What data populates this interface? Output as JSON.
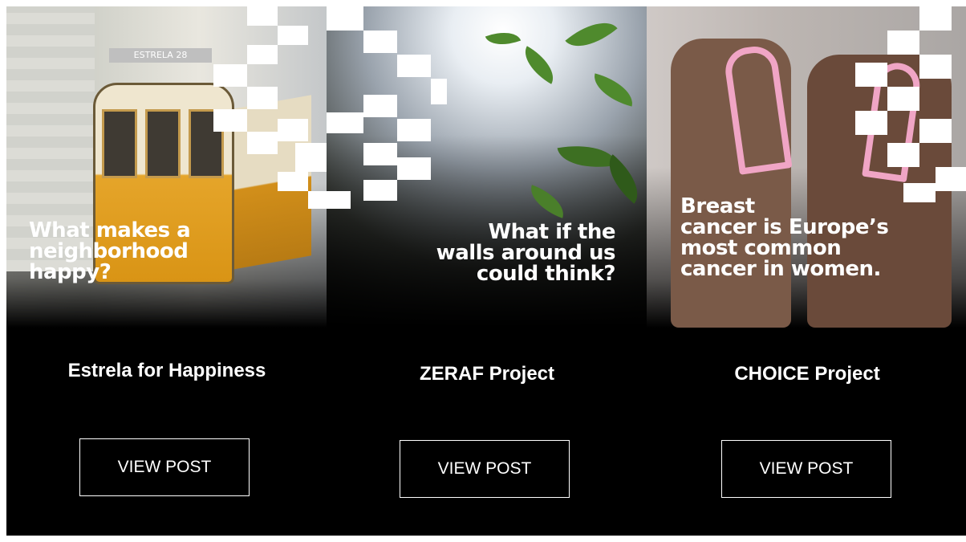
{
  "cards": [
    {
      "image_caption": "What makes a\nneighborhood\nhappy?",
      "street_sign": "ESTRELA 28",
      "title": "Estrela for Happiness",
      "button_label": "VIEW POST"
    },
    {
      "image_caption": "What if the\nwalls around us\ncould think?",
      "title": "ZERAF Project",
      "button_label": "VIEW POST"
    },
    {
      "image_caption": "Breast\ncancer is Europe’s\nmost common\ncancer in women.",
      "title": "CHOICE Project",
      "button_label": "VIEW POST"
    }
  ],
  "colors": {
    "background": "#000000",
    "text": "#ffffff",
    "button_border": "#ffffff"
  }
}
